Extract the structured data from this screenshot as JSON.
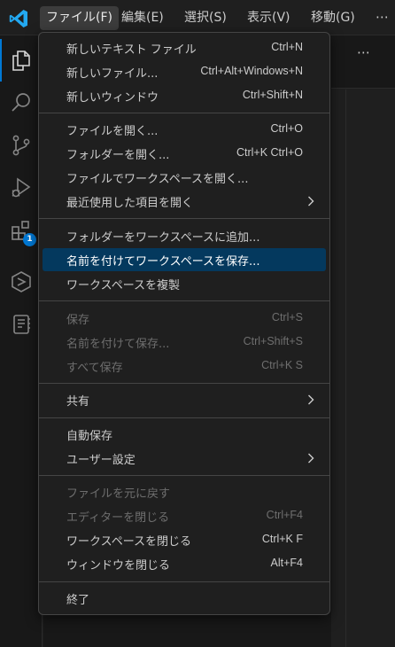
{
  "menubar": {
    "items": [
      {
        "label": "ファイル(F)",
        "active": true
      },
      {
        "label": "編集(E)"
      },
      {
        "label": "選択(S)"
      },
      {
        "label": "表示(V)"
      },
      {
        "label": "移動(G)"
      }
    ],
    "more": "⋯"
  },
  "activitybar": {
    "items": [
      {
        "icon": "explorer-icon"
      },
      {
        "icon": "search-icon"
      },
      {
        "icon": "source-control-icon"
      },
      {
        "icon": "run-debug-icon"
      },
      {
        "icon": "extensions-icon",
        "badge": "1"
      },
      {
        "icon": "remote-explorer-icon"
      },
      {
        "icon": "notebook-icon"
      }
    ]
  },
  "editor": {
    "more": "⋯"
  },
  "file_menu": {
    "groups": [
      [
        {
          "label": "新しいテキスト ファイル",
          "shortcut": "Ctrl+N"
        },
        {
          "label": "新しいファイル...",
          "shortcut": "Ctrl+Alt+Windows+N"
        },
        {
          "label": "新しいウィンドウ",
          "shortcut": "Ctrl+Shift+N"
        }
      ],
      [
        {
          "label": "ファイルを開く...",
          "shortcut": "Ctrl+O"
        },
        {
          "label": "フォルダーを開く...",
          "shortcut": "Ctrl+K Ctrl+O"
        },
        {
          "label": "ファイルでワークスペースを開く...",
          "shortcut": ""
        },
        {
          "label": "最近使用した項目を開く",
          "shortcut": "",
          "submenu": true
        }
      ],
      [
        {
          "label": "フォルダーをワークスペースに追加...",
          "shortcut": ""
        },
        {
          "label": "名前を付けてワークスペースを保存...",
          "shortcut": "",
          "selected": true
        },
        {
          "label": "ワークスペースを複製",
          "shortcut": ""
        }
      ],
      [
        {
          "label": "保存",
          "shortcut": "Ctrl+S",
          "disabled": true
        },
        {
          "label": "名前を付けて保存...",
          "shortcut": "Ctrl+Shift+S",
          "disabled": true
        },
        {
          "label": "すべて保存",
          "shortcut": "Ctrl+K S",
          "disabled": true
        }
      ],
      [
        {
          "label": "共有",
          "shortcut": "",
          "submenu": true
        }
      ],
      [
        {
          "label": "自動保存",
          "shortcut": ""
        },
        {
          "label": "ユーザー設定",
          "shortcut": "",
          "submenu": true
        }
      ],
      [
        {
          "label": "ファイルを元に戻す",
          "shortcut": "",
          "disabled": true
        },
        {
          "label": "エディターを閉じる",
          "shortcut": "Ctrl+F4",
          "disabled": true
        },
        {
          "label": "ワークスペースを閉じる",
          "shortcut": "Ctrl+K F"
        },
        {
          "label": "ウィンドウを閉じる",
          "shortcut": "Alt+F4"
        }
      ],
      [
        {
          "label": "終了",
          "shortcut": ""
        }
      ]
    ]
  },
  "colors": {
    "accent": "#0078d4",
    "selection": "#04395e",
    "logo": "#23a9f2"
  }
}
